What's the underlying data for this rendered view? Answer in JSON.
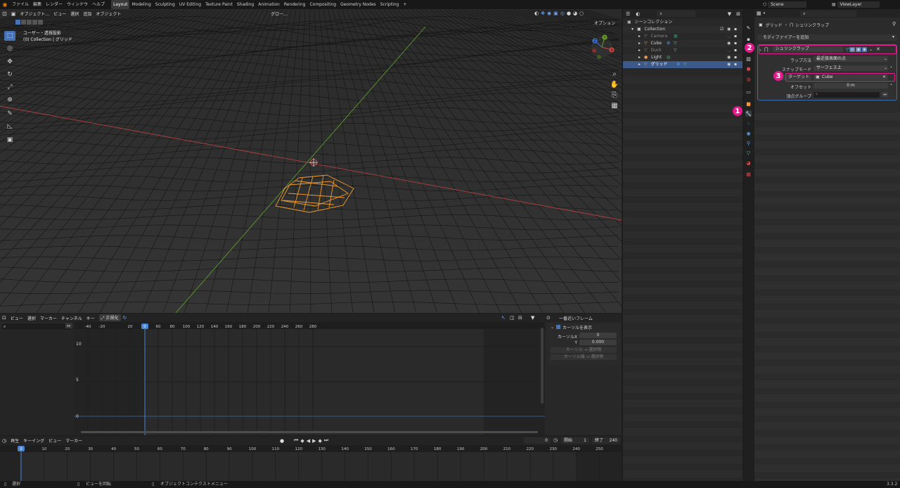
{
  "topbar": {
    "menus": [
      "ファイル",
      "編集",
      "レンダー",
      "ウィンドウ",
      "ヘルプ"
    ],
    "workspaces": [
      "Layout",
      "Modeling",
      "Sculpting",
      "UV Editing",
      "Texture Paint",
      "Shading",
      "Animation",
      "Rendering",
      "Compositing",
      "Geometry Nodes",
      "Scripting"
    ],
    "add_tab": "+",
    "scene": "Scene",
    "view_layer": "ViewLayer"
  },
  "viewport": {
    "mode": "オブジェクト…",
    "menus": [
      "ビュー",
      "選択",
      "追加",
      "オブジェクト"
    ],
    "transform_orientation": "グロー…",
    "options_label": "オプション",
    "info_line1": "ユーザー・透視投影",
    "info_line2": "(0) Collection | グリッド",
    "gizmo_axes": [
      "X",
      "Y",
      "Z"
    ]
  },
  "outliner": {
    "root": "シーンコレクション",
    "items": [
      {
        "name": "Collection"
      },
      {
        "name": "Camera"
      },
      {
        "name": "Cube"
      },
      {
        "name": "Duck"
      },
      {
        "name": "Light"
      },
      {
        "name": "グリッド"
      }
    ]
  },
  "properties": {
    "breadcrumb_object": "グリッド",
    "breadcrumb_sep": "›",
    "breadcrumb_modifier": "シュリンクラップ",
    "add_modifier": "モディファイアーを追加",
    "modifier_name": "シュリンクラップ",
    "wrap_method_label": "ラップ方法",
    "wrap_method_value": "最近接表面の点",
    "snap_mode_label": "スナップモード",
    "snap_mode_value": "サーフェス上",
    "target_label": "ターゲット",
    "target_value": "Cube",
    "offset_label": "オフセット",
    "offset_value": "0 m",
    "vertex_group_label": "頂点グループ"
  },
  "annotations": {
    "badge1": "1",
    "badge2": "2",
    "badge3": "3",
    "color": "#e5198c"
  },
  "graph": {
    "menus": [
      "ビュー",
      "選択",
      "マーカー",
      "チャンネル",
      "キー"
    ],
    "normalize": "正規化",
    "interp": "一番近いフレーム",
    "ruler": [
      "-40",
      "-20",
      "0",
      "20",
      "40",
      "60",
      "80",
      "100",
      "120",
      "140",
      "160",
      "180",
      "200",
      "220",
      "240",
      "260",
      "280"
    ],
    "y_labels": [
      "10",
      "5",
      "0"
    ],
    "side": {
      "show_cursor": "カーソルを表示",
      "cursor_x_label": "カーソルX",
      "cursor_x_value": "0",
      "cursor_y_label": "Y",
      "cursor_y_value": "0.000",
      "btn1": "カーソル → 選択物",
      "btn2": "カーソル値 → 選択物"
    }
  },
  "timeline": {
    "menus": [
      "再生",
      "キーイング",
      "ビュー",
      "マーカー"
    ],
    "current_frame": "0",
    "start_label": "開始",
    "start_value": "1",
    "end_label": "終了",
    "end_value": "240",
    "ruler": [
      "0",
      "10",
      "20",
      "30",
      "40",
      "50",
      "60",
      "70",
      "80",
      "90",
      "100",
      "110",
      "120",
      "130",
      "140",
      "150",
      "160",
      "170",
      "180",
      "190",
      "200",
      "210",
      "220",
      "230",
      "240",
      "250"
    ]
  },
  "statusbar": {
    "select": "選択",
    "rotate": "ビューを回転",
    "context": "オブジェクトコンテクストメニュー",
    "version": "3.3.2"
  },
  "colors": {
    "accent": "#4772b3",
    "selection_orange": "#f09a2a",
    "x_axis": "#d04545",
    "y_axis": "#6aa02a"
  }
}
